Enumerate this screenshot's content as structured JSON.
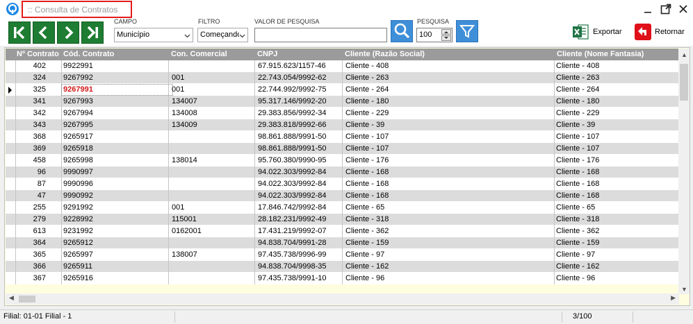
{
  "window": {
    "title": ":: Consulta de Contratos",
    "app_icon": "app-logo-icon",
    "minimize_icon": "minimize-icon",
    "restore_icon": "restore-icon",
    "close_icon": "close-icon"
  },
  "toolbar": {
    "nav_buttons": [
      "first-record-icon",
      "previous-record-icon",
      "next-record-icon",
      "last-record-icon"
    ],
    "campo_label": "CAMPO",
    "campo_value": "Município",
    "filtro_label": "FILTRO",
    "filtro_value": "Começando",
    "valor_label": "VALOR DE PESQUISA",
    "valor_value": "",
    "pesquisa_label": "PESQUISA",
    "pesquisa_value": "100",
    "export_label": "Exportar",
    "return_label": "Retornar",
    "colors": {
      "nav_green": "#1e7d32",
      "search_blue": "#3f8fd8",
      "return_red": "#e0101a",
      "excel_green": "#217346"
    }
  },
  "grid": {
    "columns": [
      "Nº Contrato",
      "Cód. Contrato",
      "Con. Comercial",
      "CNPJ",
      "Cliente (Razão Social)",
      "Cliente (Nome Fantasia)"
    ],
    "rows": [
      [
        "402",
        "9922991",
        "",
        "67.915.623/1157-46",
        "Cliente - 408",
        "Cliente - 408"
      ],
      [
        "324",
        "9267992",
        "001",
        "22.743.054/9992-62",
        "Cliente - 263",
        "Cliente - 263"
      ],
      [
        "325",
        "9267991",
        "001",
        "22.744.992/9992-75",
        "Cliente - 264",
        "Cliente - 264"
      ],
      [
        "341",
        "9267993",
        "134007",
        "95.317.146/9992-20",
        "Cliente - 180",
        "Cliente - 180"
      ],
      [
        "342",
        "9267994",
        "134008",
        "29.383.856/9992-34",
        "Cliente - 229",
        "Cliente - 229"
      ],
      [
        "343",
        "9267995",
        "134009",
        "29.383.818/9992-66",
        "Cliente - 39",
        "Cliente - 39"
      ],
      [
        "368",
        "9265917",
        "",
        "98.861.888/9991-50",
        "Cliente - 107",
        "Cliente - 107"
      ],
      [
        "369",
        "9265918",
        "",
        "98.861.888/9991-50",
        "Cliente - 107",
        "Cliente - 107"
      ],
      [
        "458",
        "9265998",
        "138014",
        "95.760.380/9990-95",
        "Cliente - 176",
        "Cliente - 176"
      ],
      [
        "96",
        "9990997",
        "",
        "94.022.303/9992-84",
        "Cliente - 168",
        "Cliente - 168"
      ],
      [
        "87",
        "9990996",
        "",
        "94.022.303/9992-84",
        "Cliente - 168",
        "Cliente - 168"
      ],
      [
        "47",
        "9990992",
        "",
        "94.022.303/9992-84",
        "Cliente - 168",
        "Cliente - 168"
      ],
      [
        "255",
        "9291992",
        "001",
        "17.846.742/9992-84",
        "Cliente - 65",
        "Cliente - 65"
      ],
      [
        "279",
        "9228992",
        "115001",
        "28.182.231/9992-49",
        "Cliente - 318",
        "Cliente - 318"
      ],
      [
        "613",
        "9231992",
        "0162001",
        "17.431.219/9992-07",
        "Cliente - 362",
        "Cliente - 362"
      ],
      [
        "364",
        "9265912",
        "",
        "94.838.704/9991-28",
        "Cliente - 159",
        "Cliente - 159"
      ],
      [
        "365",
        "9265997",
        "138007",
        "97.435.738/9996-99",
        "Cliente - 97",
        "Cliente - 97"
      ],
      [
        "366",
        "9265911",
        "",
        "94.838.704/9998-35",
        "Cliente - 162",
        "Cliente - 162"
      ],
      [
        "367",
        "9265916",
        "",
        "97.435.738/9991-10",
        "Cliente - 96",
        "Cliente - 96"
      ]
    ],
    "selected_row_index": 2,
    "selected_column_index": 1
  },
  "status": {
    "filial": "Filial: 01-01 Filial - 1",
    "count": "3/100"
  }
}
